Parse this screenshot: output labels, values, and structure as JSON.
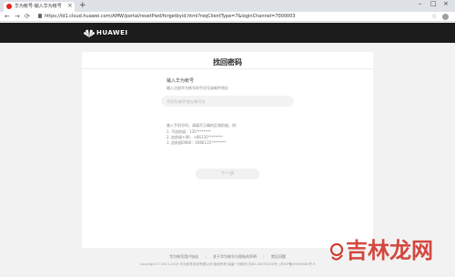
{
  "browser": {
    "tab_title": "华为帐号-输入华为帐号",
    "tab_close": "×",
    "new_tab": "+",
    "window_controls": [
      "–",
      "□",
      "×"
    ],
    "nav": [
      "←",
      "→",
      "⟳"
    ],
    "url": "https://id1.cloud.huawei.com/AMW/portal/resetPwd/forgetbyid.html?reqClientType=7&loginChannel=7000003",
    "star": "☆"
  },
  "header": {
    "brand": "HUAWEI"
  },
  "form": {
    "title": "找回密码",
    "account_label": "输入华为帐号",
    "account_sublabel": "输入注册华为帐号的手机号或邮件地址",
    "account_placeholder": "手机号/邮件地址/帐号名",
    "hints": [
      "输入手机号时，请填写正确的区域前缀，如:",
      "1. 不加前缀：135********",
      "2. 加前缀+86：+86135********",
      "3. 加前缀0086：0086135********"
    ],
    "next_label": "下一步"
  },
  "footer": {
    "links": [
      "华为帐号用户协议",
      "关于华为帐号与隐私的声明",
      "常见问题"
    ],
    "separator": "|",
    "copyright": "Copyright © 2011-2019 华为软件技术有限公司 版权所有 保留一切权利 苏B2-20070200号 | 苏ICP备09062682号-9"
  },
  "watermark": {
    "text": "吉林龙网"
  },
  "colors": {
    "accent": "#e2231a",
    "header_bg": "#1c1c1c",
    "watermark": "#d0352b"
  },
  "icons": {
    "lock": "lock-icon",
    "avatar": "account-icon",
    "logo": "huawei-logo-icon"
  }
}
